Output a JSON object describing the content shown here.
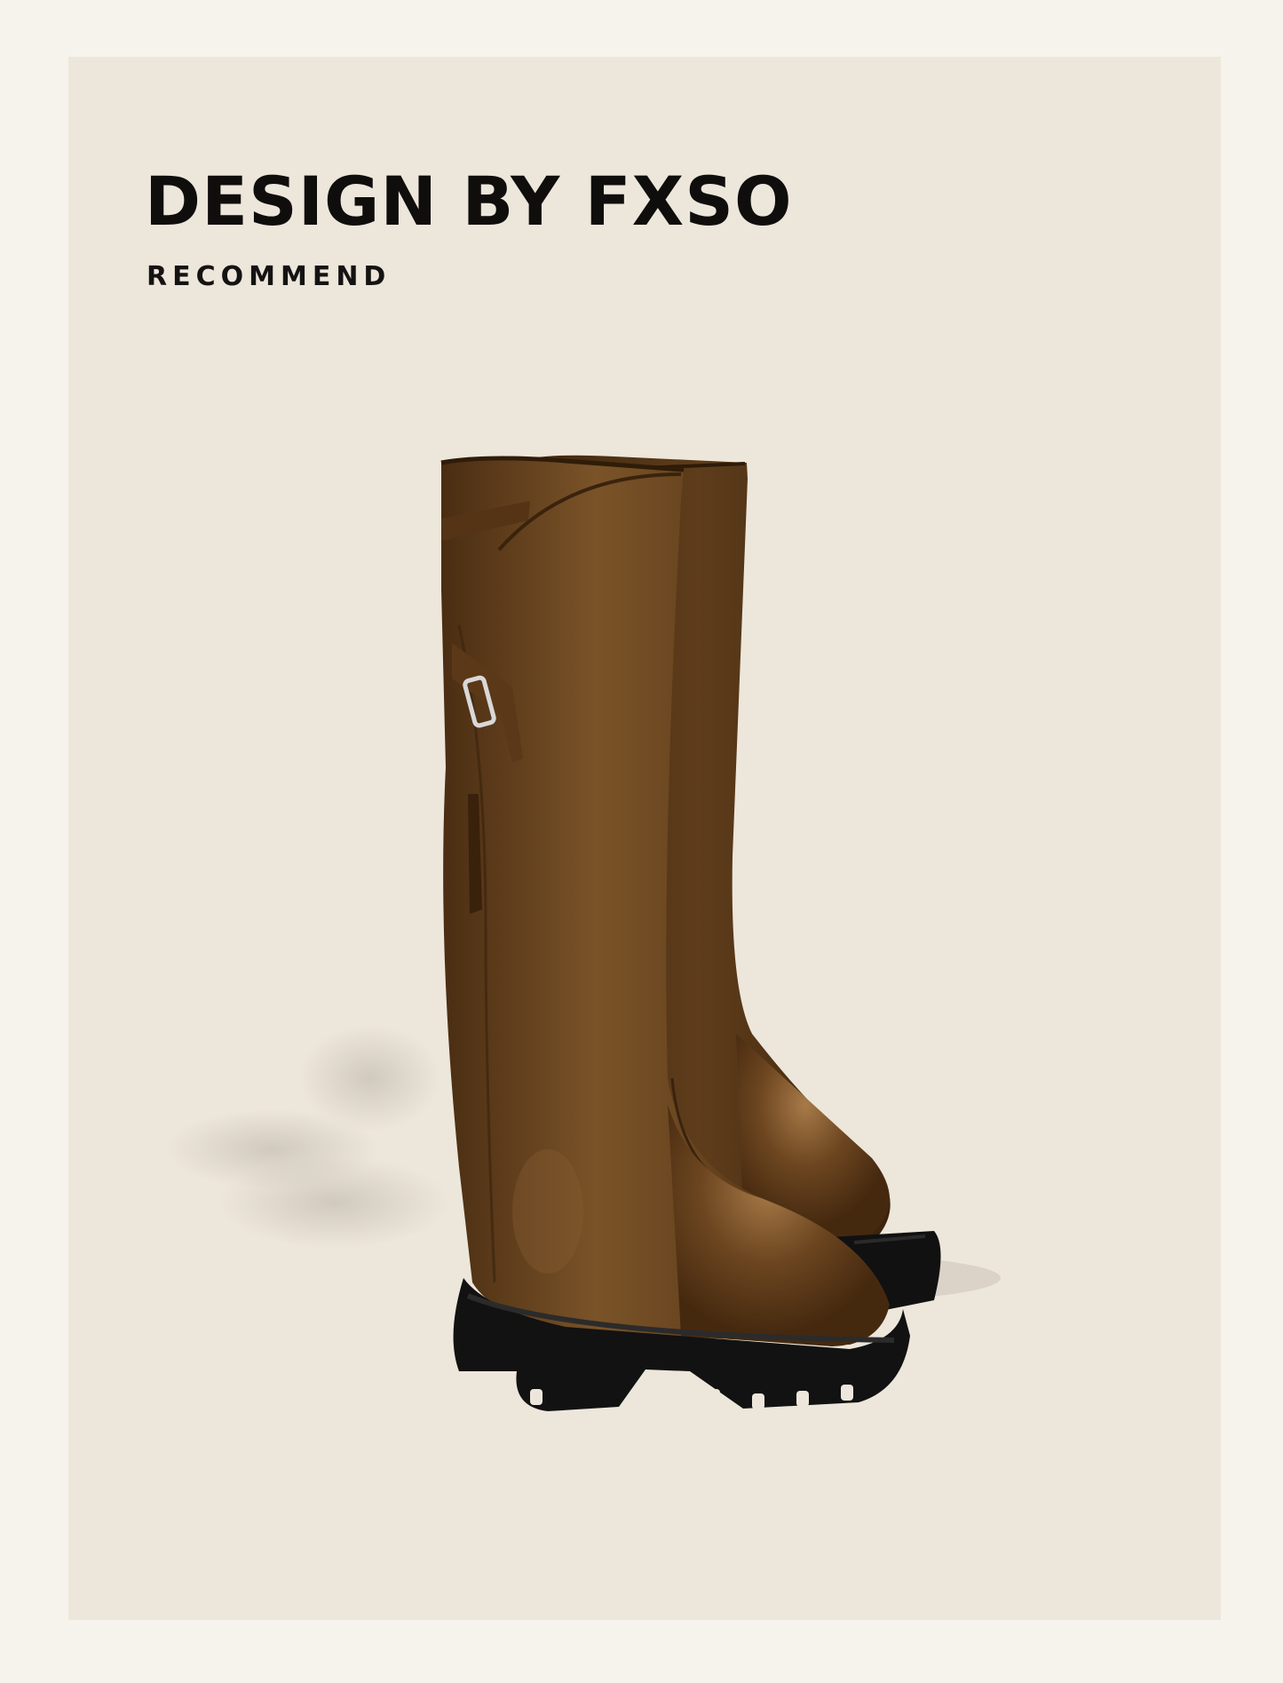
{
  "headline": "DESIGN BY FXSO",
  "subheadline": "RECOMMEND",
  "product": {
    "icon": "knee-high-boots-photo",
    "leather_color": "#6b4420",
    "sole_color": "#111111"
  },
  "colors": {
    "page_background": "#f6f3ec",
    "panel_background": "#ede6db",
    "text": "#0f0e0d"
  }
}
